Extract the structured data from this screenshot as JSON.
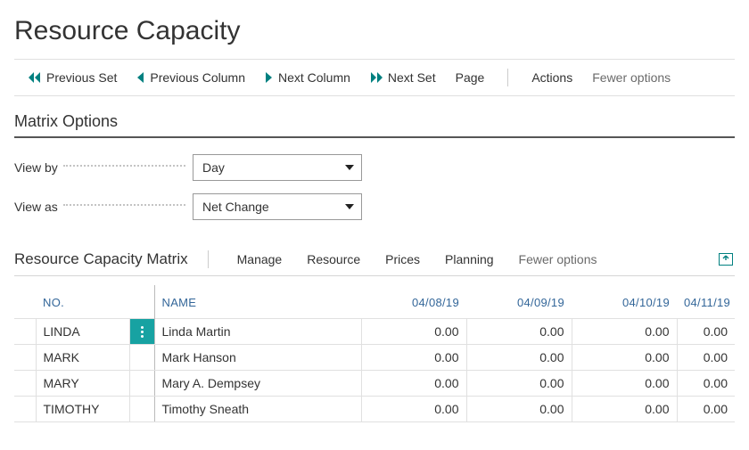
{
  "page": {
    "title": "Resource Capacity"
  },
  "toolbar": {
    "prev_set": "Previous Set",
    "prev_col": "Previous Column",
    "next_col": "Next Column",
    "next_set": "Next Set",
    "page": "Page",
    "actions": "Actions",
    "fewer": "Fewer options"
  },
  "matrix_options": {
    "section_title": "Matrix Options",
    "view_by": {
      "label": "View by",
      "value": "Day"
    },
    "view_as": {
      "label": "View as",
      "value": "Net Change"
    }
  },
  "matrix": {
    "section_title": "Resource Capacity Matrix",
    "actions": {
      "manage": "Manage",
      "resource": "Resource",
      "prices": "Prices",
      "planning": "Planning",
      "fewer": "Fewer options"
    },
    "headers": {
      "no": "NO.",
      "name": "NAME",
      "d1": "04/08/19",
      "d2": "04/09/19",
      "d3": "04/10/19",
      "d4": "04/11/19"
    },
    "rows": [
      {
        "no": "LINDA",
        "name": "Linda Martin",
        "d1": "0.00",
        "d2": "0.00",
        "d3": "0.00",
        "d4": "0.00",
        "active": true
      },
      {
        "no": "MARK",
        "name": "Mark Hanson",
        "d1": "0.00",
        "d2": "0.00",
        "d3": "0.00",
        "d4": "0.00",
        "active": false
      },
      {
        "no": "MARY",
        "name": "Mary A. Dempsey",
        "d1": "0.00",
        "d2": "0.00",
        "d3": "0.00",
        "d4": "0.00",
        "active": false
      },
      {
        "no": "TIMOTHY",
        "name": "Timothy Sneath",
        "d1": "0.00",
        "d2": "0.00",
        "d3": "0.00",
        "d4": "0.00",
        "active": false
      }
    ]
  }
}
